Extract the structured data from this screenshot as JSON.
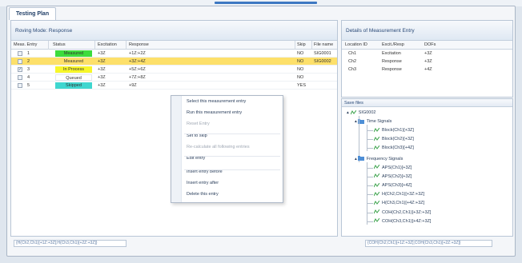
{
  "tab": {
    "label": "Testing Plan"
  },
  "roving": {
    "label": "Roving Mode:",
    "value": "Response"
  },
  "table": {
    "columns": [
      "Meas. Entry",
      "Status",
      "Excitation",
      "Response",
      "Skip",
      "File name"
    ],
    "rows": [
      {
        "id": "1",
        "checked": false,
        "status": "Measured",
        "status_color": "#3ddc3d",
        "excitation": "+3Z",
        "response": "+1Z:+2Z",
        "skip": "NO",
        "file": "SIG0001"
      },
      {
        "id": "2",
        "checked": false,
        "status": "Measured",
        "status_color": "#fde06a",
        "excitation": "+3Z",
        "response": "+3Z:+4Z",
        "skip": "NO",
        "file": "SIG0002",
        "selected": true
      },
      {
        "id": "3",
        "checked": true,
        "status": "In Process",
        "status_color": "#f7f72a",
        "excitation": "+3Z",
        "response": "+5Z:+6Z",
        "skip": "NO",
        "file": ""
      },
      {
        "id": "4",
        "checked": false,
        "status": "Queued",
        "status_color": "#ffffff",
        "excitation": "+3Z",
        "response": "+7Z:+8Z",
        "skip": "NO",
        "file": ""
      },
      {
        "id": "5",
        "checked": false,
        "status": "Skipped",
        "status_color": "#3fd6cf",
        "excitation": "+3Z",
        "response": "+9Z",
        "skip": "YES",
        "file": ""
      }
    ]
  },
  "context_menu": {
    "items": [
      {
        "label": "Select this measurement entry",
        "enabled": true
      },
      {
        "label": "Run this measurement entry",
        "enabled": true
      },
      {
        "label": "Reset Entry",
        "enabled": false
      },
      {
        "label": "Set to skip",
        "enabled": true
      },
      {
        "label": "Re-calculate all following entries",
        "enabled": false
      },
      {
        "label": "Edit entry",
        "enabled": true
      },
      {
        "label": "Insert entry before",
        "enabled": true
      },
      {
        "label": "Insert entry after",
        "enabled": true
      },
      {
        "label": "Delete this entry",
        "enabled": true
      }
    ]
  },
  "details": {
    "title": "Details of Measurement Entry",
    "columns": [
      "Location ID",
      "Excit./Resp",
      "DOFs"
    ],
    "rows": [
      {
        "loc": "Ch1",
        "type": "Excitation",
        "dof": "+3Z"
      },
      {
        "loc": "Ch2",
        "type": "Response",
        "dof": "+3Z"
      },
      {
        "loc": "Ch3",
        "type": "Response",
        "dof": "+4Z"
      }
    ]
  },
  "save_files": {
    "title": "Save files",
    "root": "SIG0002",
    "groups": [
      {
        "label": "Time Signals",
        "children": [
          "Block(Ch1)[+3Z]",
          "Block(Ch2)[+3Z]",
          "Block(Ch3)[+4Z]"
        ]
      },
      {
        "label": "Frequency Signals",
        "children": [
          "APS(Ch1)[+3Z]",
          "APS(Ch2)[+3Z]",
          "APS(Ch3)[+4Z]",
          "H(Ch2,Ch1)[+3Z:+3Z]",
          "H(Ch3,Ch1)[+4Z:+3Z]",
          "COH(Ch2,Ch1)[+3Z:+3Z]",
          "COH(Ch3,Ch1)[+4Z:+3Z]"
        ]
      }
    ]
  },
  "bottom": {
    "left": "{H(Ch2,Ch1)[+1Z:+3Z];H(Ch3,Ch1)[+2Z:+3Z]}",
    "right": "{COH(Ch2,Ch1)[+1Z:+3Z];COH(Ch3,Ch1)[+2Z:+3Z]}"
  }
}
